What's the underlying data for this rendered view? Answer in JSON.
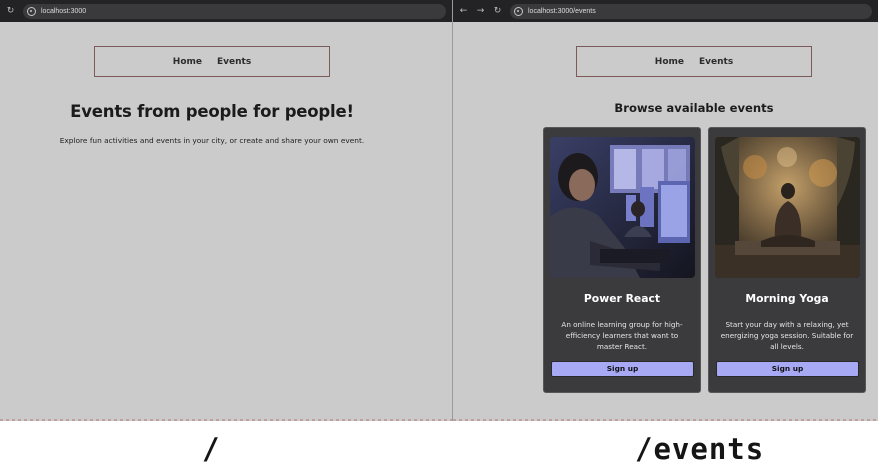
{
  "left_window": {
    "url": "localhost:3000",
    "nav": {
      "home": "Home",
      "events": "Events"
    },
    "hero_title": "Events from people for people!",
    "hero_text": "Explore fun activities and events in your city, or create and share your own event.",
    "route_label": "/"
  },
  "right_window": {
    "url": "localhost:3000/events",
    "nav": {
      "home": "Home",
      "events": "Events"
    },
    "page_title": "Browse available events",
    "route_label": "/events",
    "events": [
      {
        "title": "Power React",
        "description": "An online learning group for high-efficiency learners that want to master React.",
        "button": "Sign up"
      },
      {
        "title": "Morning Yoga",
        "description": "Start your day with a relaxing, yet energizing yoga session. Suitable for all levels.",
        "button": "Sign up"
      }
    ]
  },
  "icons": {
    "reload": "reload-icon",
    "back": "back-arrow-icon",
    "forward": "forward-arrow-icon",
    "site_info": "site-info-icon"
  },
  "colors": {
    "page_background": "#cbcbcb",
    "card_background": "#3b3b3d",
    "button_accent": "#a7a9f5",
    "browser_chrome": "#232325"
  }
}
